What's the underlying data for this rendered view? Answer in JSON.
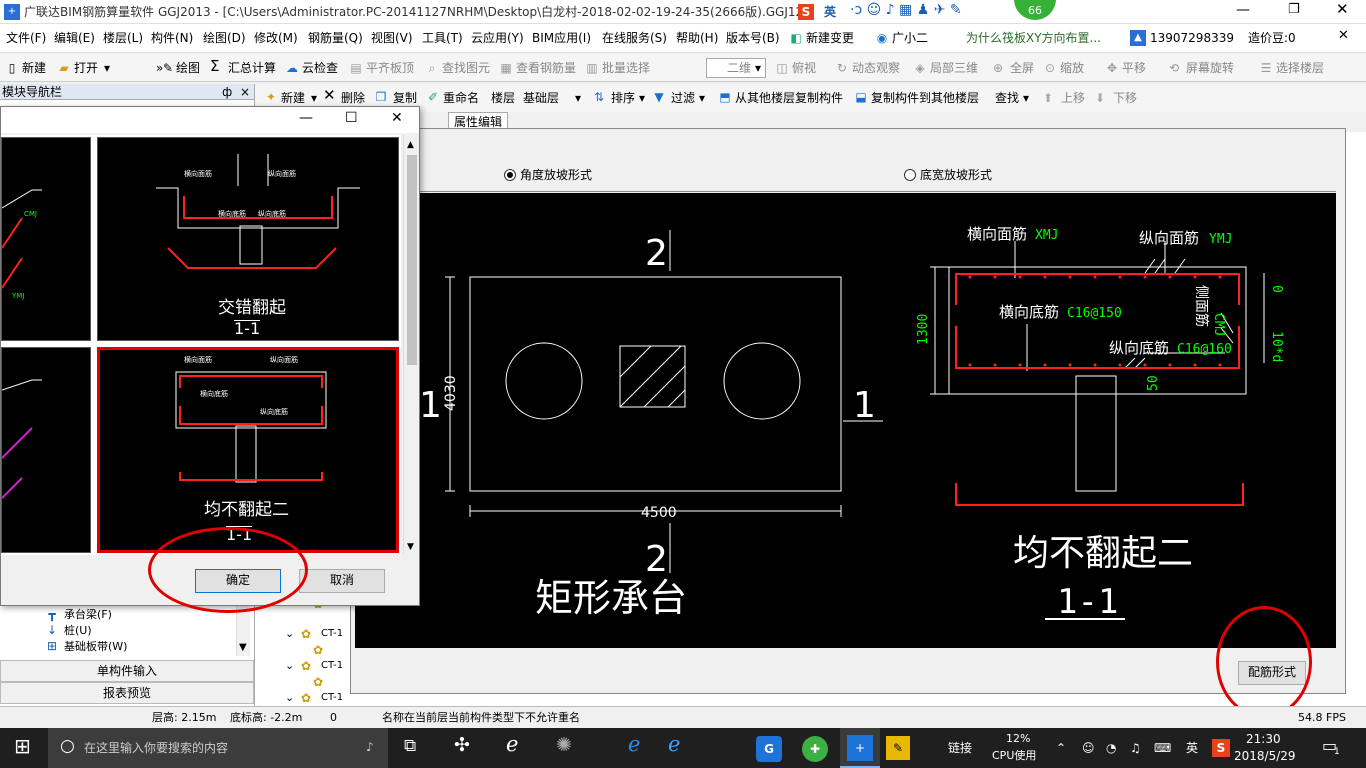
{
  "window": {
    "title": "广联达BIM钢筋算量软件 GGJ2013 - [C:\\Users\\Administrator.PC-20141127NRHM\\Desktop\\白龙村-2018-02-02-19-24-35(2666版).GGJ12]",
    "ime": "英",
    "badge": "66"
  },
  "menubar": {
    "items": [
      "文件(F)",
      "编辑(E)",
      "楼层(L)",
      "构件(N)",
      "绘图(D)",
      "修改(M)",
      "钢筋量(Q)",
      "视图(V)",
      "工具(T)",
      "云应用(Y)",
      "BIM应用(I)",
      "在线服务(S)",
      "帮助(H)",
      "版本号(B)"
    ],
    "new_change": "新建变更",
    "assistant": "广小二",
    "question": "为什么筏板XY方向布置...",
    "phone": "13907298339",
    "price_bean": "造价豆:0"
  },
  "toolbar1": {
    "new": "新建",
    "open": "打开",
    "draw": "绘图",
    "sum": "汇总计算",
    "cloud_check": "云检查",
    "flat_top": "平齐板顶",
    "find_elem": "查找图元",
    "view_rebar": "查看钢筋量",
    "batch_select": "批量选择",
    "view_mode": "二维",
    "top_view": "俯视",
    "dynamic": "动态观察",
    "local_3d": "局部三维",
    "fullscreen": "全屏",
    "zoom": "缩放",
    "pan": "平移",
    "rotate": "屏幕旋转",
    "select_floor": "选择楼层"
  },
  "navpanel": {
    "title": "模块导航栏",
    "pin": "ф",
    "close": "×",
    "tree": [
      {
        "label": "承台梁(F)"
      },
      {
        "label": "桩(U)"
      },
      {
        "label": "基础板带(W)"
      }
    ],
    "single_input": "单构件输入",
    "report_preview": "报表预览"
  },
  "toolbar2": {
    "new": "新建",
    "delete": "删除",
    "copy": "复制",
    "rename": "重命名",
    "floor_label": "楼层",
    "floor_value": "基础层",
    "sort": "排序",
    "filter": "过滤",
    "copy_from": "从其他楼层复制构件",
    "copy_to": "复制构件到其他楼层",
    "find": "查找",
    "move_up": "上移",
    "move_down": "下移"
  },
  "tabs": {
    "property_edit": "属性编辑"
  },
  "options": {
    "angle": "角度放坡形式",
    "width": "底宽放坡形式",
    "selected": "angle"
  },
  "drawing": {
    "left_title": "矩形承台",
    "section_top": "2",
    "section_bottom": "2",
    "section_right": "1",
    "section_left": "1",
    "dim_height": "4030",
    "dim_width": "4500",
    "right_title": "均不翻起二",
    "right_section": "1-1",
    "xmj_label": "横向面筋",
    "xmj_code": "XMJ",
    "ymj_label": "纵向面筋",
    "ymj_code": "YMJ",
    "xdj_label": "横向底筋",
    "xdj_value": "C16@150",
    "ydj_label": "纵向底筋",
    "ydj_value": "C16@160",
    "side_label": "侧面筋",
    "side_code": "CMJ",
    "dim_1300": "1300",
    "dim_0": "0",
    "dim_10d": "10*d",
    "dim_50": "50",
    "rebar_form_button": "配筋形式"
  },
  "dialog": {
    "thumb1_title": "交错翻起",
    "thumb1_section": "1-1",
    "thumb2_title": "均不翻起二",
    "thumb2_section": "1-1",
    "ok": "确定",
    "cancel": "取消"
  },
  "tree_right": [
    "CT-1",
    "CT-1",
    "CT-1"
  ],
  "statusbar": {
    "floor_height": "层高: 2.15m",
    "base_height": "底标高: -2.2m",
    "zero": "0",
    "message": "名称在当前层当前构件类型下不允许重名",
    "fps": "54.8 FPS"
  },
  "taskbar": {
    "search_placeholder": "在这里输入你要搜索的内容",
    "link": "链接",
    "cpu_pct": "12%",
    "cpu_label": "CPU使用",
    "ime": "英",
    "time": "21:30",
    "date": "2018/5/29",
    "notify": "1"
  },
  "colors": {
    "annotation_red": "#e00000",
    "rebar_red": "#ff2020",
    "cad_green": "#00ff00",
    "selected_border": "#e00000"
  }
}
